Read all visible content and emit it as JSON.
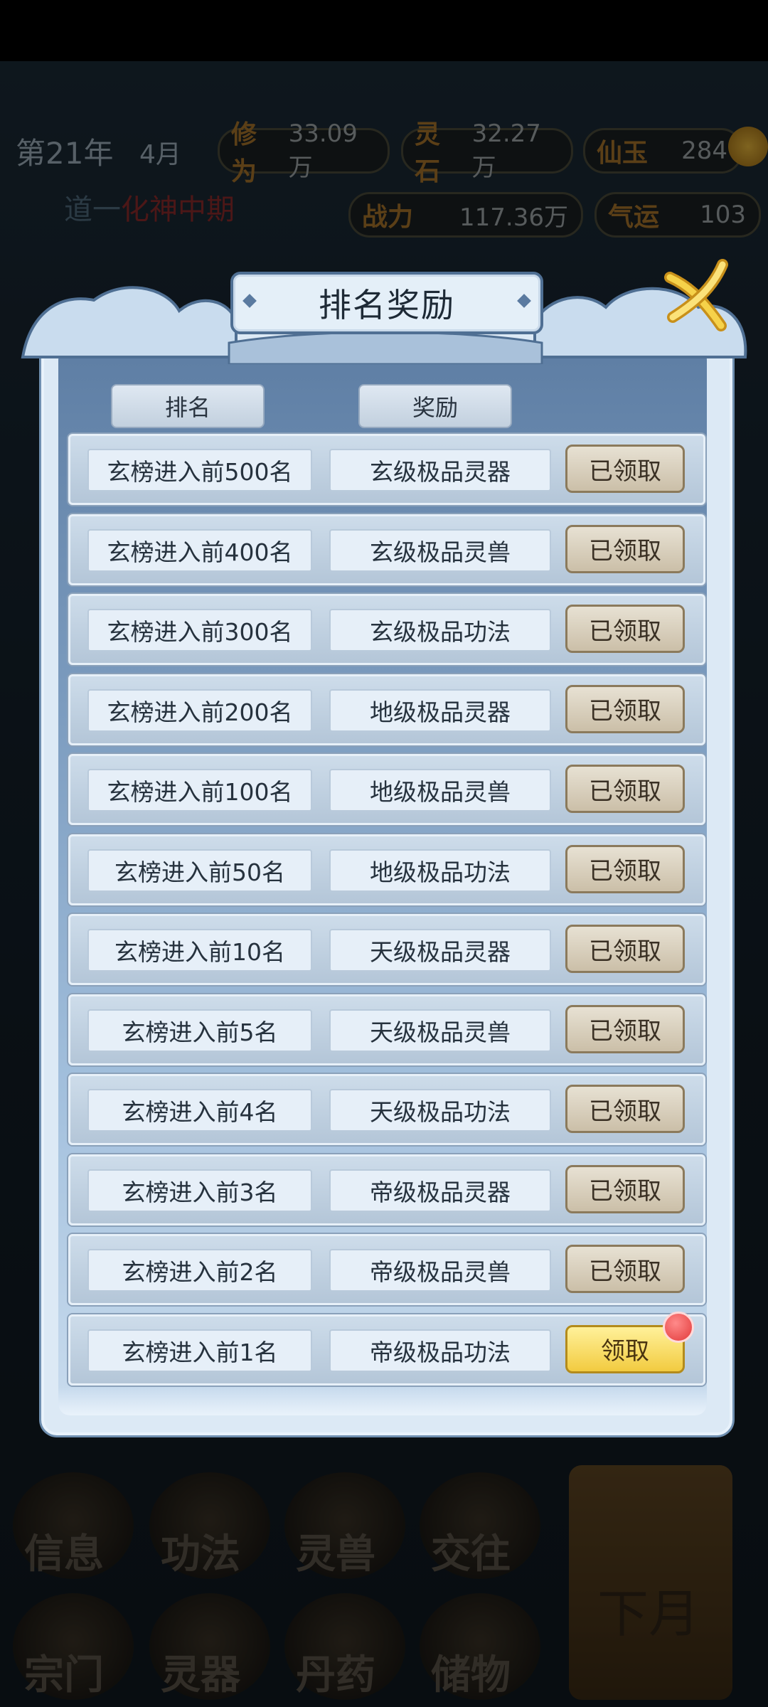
{
  "hud": {
    "year": "第21年",
    "month": "4月",
    "cultivation": {
      "label": "修为",
      "value": "33.09万"
    },
    "spirit_stone": {
      "label": "灵石",
      "value": "32.27万"
    },
    "jade": {
      "label": "仙玉",
      "value": "284"
    },
    "realm_prefix": "道一",
    "realm": "化神中期",
    "combat": {
      "label": "战力",
      "value": "117.36万"
    },
    "luck": {
      "label": "气运",
      "value": "103"
    }
  },
  "dialog": {
    "title": "排名奖励",
    "col_rank": "排名",
    "col_reward": "奖励",
    "rows": [
      {
        "rank": "玄榜进入前500名",
        "reward": "玄级极品灵器",
        "button": "已领取",
        "state": "claimed"
      },
      {
        "rank": "玄榜进入前400名",
        "reward": "玄级极品灵兽",
        "button": "已领取",
        "state": "claimed"
      },
      {
        "rank": "玄榜进入前300名",
        "reward": "玄级极品功法",
        "button": "已领取",
        "state": "claimed"
      },
      {
        "rank": "玄榜进入前200名",
        "reward": "地级极品灵器",
        "button": "已领取",
        "state": "claimed"
      },
      {
        "rank": "玄榜进入前100名",
        "reward": "地级极品灵兽",
        "button": "已领取",
        "state": "claimed"
      },
      {
        "rank": "玄榜进入前50名",
        "reward": "地级极品功法",
        "button": "已领取",
        "state": "claimed"
      },
      {
        "rank": "玄榜进入前10名",
        "reward": "天级极品灵器",
        "button": "已领取",
        "state": "claimed"
      },
      {
        "rank": "玄榜进入前5名",
        "reward": "天级极品灵兽",
        "button": "已领取",
        "state": "claimed"
      },
      {
        "rank": "玄榜进入前4名",
        "reward": "天级极品功法",
        "button": "已领取",
        "state": "claimed"
      },
      {
        "rank": "玄榜进入前3名",
        "reward": "帝级极品灵器",
        "button": "已领取",
        "state": "claimed"
      },
      {
        "rank": "玄榜进入前2名",
        "reward": "帝级极品灵兽",
        "button": "已领取",
        "state": "claimed"
      },
      {
        "rank": "玄榜进入前1名",
        "reward": "帝级极品功法",
        "button": "领取",
        "state": "claimable"
      }
    ]
  },
  "bottom_nav": [
    "信息",
    "功法",
    "灵兽",
    "交往",
    "宗门",
    "灵器",
    "丹药",
    "储物"
  ],
  "next_month": "下月",
  "colors": {
    "panel": "#7d9dc0",
    "claim": "#f2cb40",
    "claimed": "#cbbfa8",
    "badge": "#e23a3a"
  }
}
